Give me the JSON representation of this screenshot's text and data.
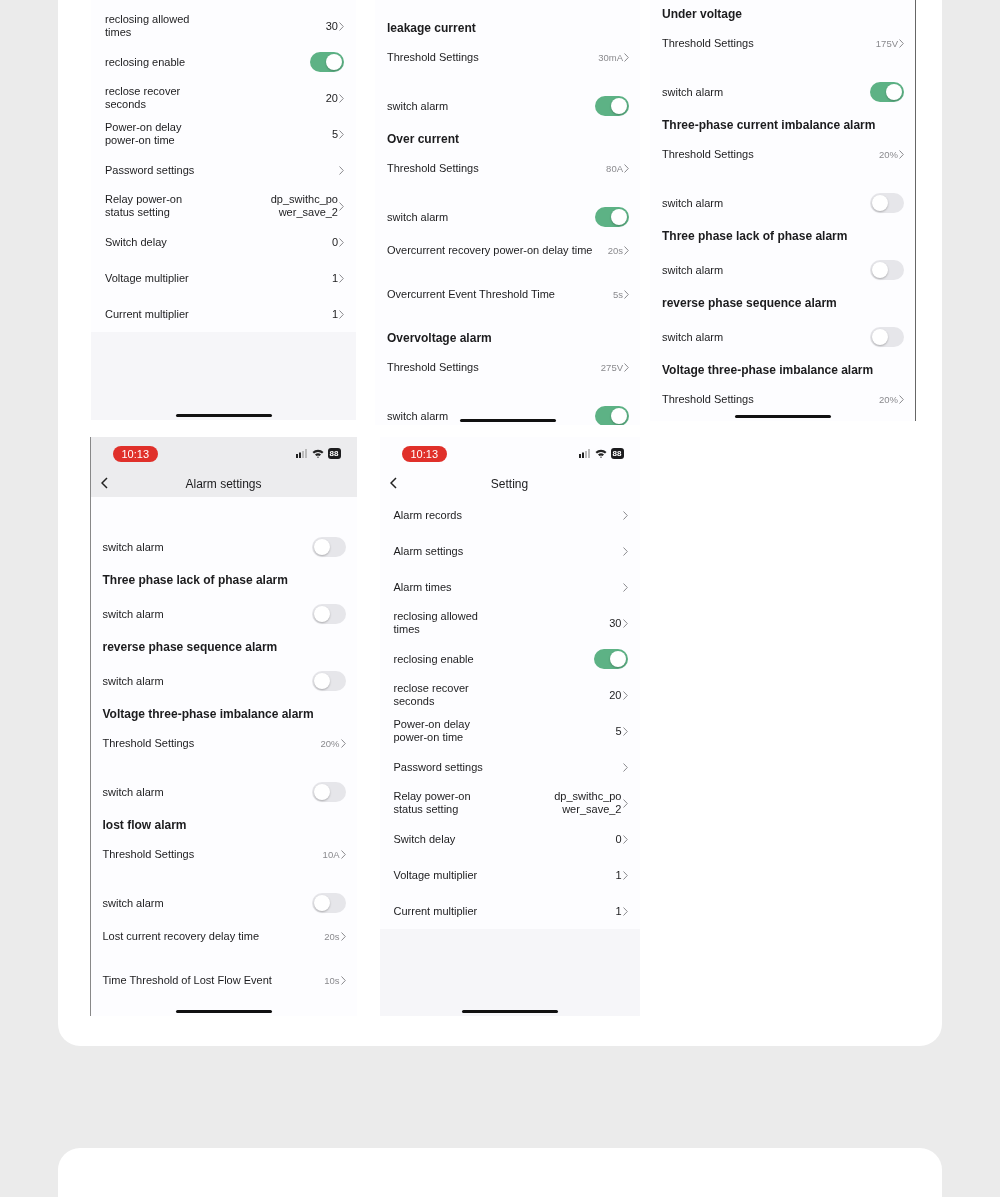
{
  "screens": [
    {
      "kind": "settings",
      "rows": [
        {
          "kind": "value",
          "label": "reclosing allowed times",
          "value": "30"
        },
        {
          "kind": "toggle",
          "label": "reclosing enable",
          "on": true
        },
        {
          "kind": "value",
          "label": "reclose recover seconds",
          "value": "20"
        },
        {
          "kind": "value",
          "label": "Power-on delay power-on time",
          "value": "5"
        },
        {
          "kind": "link",
          "label": "Password settings"
        },
        {
          "kind": "value",
          "label": "Relay power-on status setting",
          "value": "dp_swithc_power_save_2"
        },
        {
          "kind": "value",
          "label": "Switch delay",
          "value": "0"
        },
        {
          "kind": "value",
          "label": "Voltage multiplier",
          "value": "1"
        },
        {
          "kind": "value",
          "label": "Current multiplier",
          "value": "1"
        }
      ]
    },
    {
      "kind": "alarms",
      "rows": [
        {
          "kind": "heading",
          "label": "leakage current"
        },
        {
          "kind": "value",
          "label": "Threshold Settings",
          "value": "30mA"
        },
        {
          "kind": "toggle",
          "label": "switch alarm",
          "on": true
        },
        {
          "kind": "heading",
          "label": "Over current"
        },
        {
          "kind": "value",
          "label": "Threshold Settings",
          "value": "80A"
        },
        {
          "kind": "toggle",
          "label": "switch alarm",
          "on": true
        },
        {
          "kind": "value",
          "label": "Overcurrent recovery power-on delay time",
          "value": "20s"
        },
        {
          "kind": "value",
          "label": "Overcurrent Event Threshold Time",
          "value": "5s"
        },
        {
          "kind": "heading",
          "label": "Overvoltage alarm"
        },
        {
          "kind": "value",
          "label": "Threshold Settings",
          "value": "275V"
        },
        {
          "kind": "toggle",
          "label": "switch alarm",
          "on": true
        }
      ]
    },
    {
      "kind": "alarms",
      "rows": [
        {
          "kind": "heading",
          "label": "Under voltage"
        },
        {
          "kind": "value",
          "label": "Threshold Settings",
          "value": "175V"
        },
        {
          "kind": "toggle",
          "label": "switch alarm",
          "on": true
        },
        {
          "kind": "heading",
          "label": "Three-phase current imbalance alarm"
        },
        {
          "kind": "value",
          "label": "Threshold Settings",
          "value": "20%"
        },
        {
          "kind": "toggle",
          "label": "switch alarm",
          "on": false
        },
        {
          "kind": "heading",
          "label": "Three phase lack of phase alarm"
        },
        {
          "kind": "toggle",
          "label": "switch alarm",
          "on": false
        },
        {
          "kind": "heading",
          "label": "reverse phase sequence alarm"
        },
        {
          "kind": "toggle",
          "label": "switch alarm",
          "on": false
        },
        {
          "kind": "heading",
          "label": "Voltage three-phase imbalance alarm"
        },
        {
          "kind": "value",
          "label": "Threshold Settings",
          "value": "20%"
        }
      ]
    },
    {
      "kind": "alarms",
      "status_bar": {
        "time": "10:13",
        "battery": "88"
      },
      "title": "Alarm settings",
      "rows": [
        {
          "kind": "toggle",
          "label": "switch alarm",
          "on": false
        },
        {
          "kind": "heading",
          "label": "Three phase lack of phase alarm"
        },
        {
          "kind": "toggle",
          "label": "switch alarm",
          "on": false
        },
        {
          "kind": "heading",
          "label": "reverse phase sequence alarm"
        },
        {
          "kind": "toggle",
          "label": "switch alarm",
          "on": false
        },
        {
          "kind": "heading",
          "label": "Voltage three-phase imbalance alarm"
        },
        {
          "kind": "value",
          "label": "Threshold Settings",
          "value": "20%"
        },
        {
          "kind": "toggle",
          "label": "switch alarm",
          "on": false
        },
        {
          "kind": "heading",
          "label": "lost flow alarm"
        },
        {
          "kind": "value",
          "label": "Threshold Settings",
          "value": "10A"
        },
        {
          "kind": "toggle",
          "label": "switch alarm",
          "on": false
        },
        {
          "kind": "value",
          "label": "Lost current recovery delay time",
          "value": "20s"
        },
        {
          "kind": "value",
          "label": "Time Threshold of Lost Flow Event",
          "value": "10s"
        }
      ]
    },
    {
      "kind": "settings",
      "status_bar": {
        "time": "10:13",
        "battery": "88"
      },
      "title": "Setting",
      "rows": [
        {
          "kind": "link",
          "label": "Alarm records"
        },
        {
          "kind": "link",
          "label": "Alarm settings"
        },
        {
          "kind": "link",
          "label": "Alarm times"
        },
        {
          "kind": "value",
          "label": "reclosing allowed times",
          "value": "30"
        },
        {
          "kind": "toggle",
          "label": "reclosing enable",
          "on": true
        },
        {
          "kind": "value",
          "label": "reclose recover seconds",
          "value": "20"
        },
        {
          "kind": "value",
          "label": "Power-on delay power-on time",
          "value": "5"
        },
        {
          "kind": "link",
          "label": "Password settings"
        },
        {
          "kind": "value",
          "label": "Relay power-on status setting",
          "value": "dp_swithc_power_save_2"
        },
        {
          "kind": "value",
          "label": "Switch delay",
          "value": "0"
        },
        {
          "kind": "value",
          "label": "Voltage multiplier",
          "value": "1"
        },
        {
          "kind": "value",
          "label": "Current multiplier",
          "value": "1"
        }
      ]
    }
  ]
}
